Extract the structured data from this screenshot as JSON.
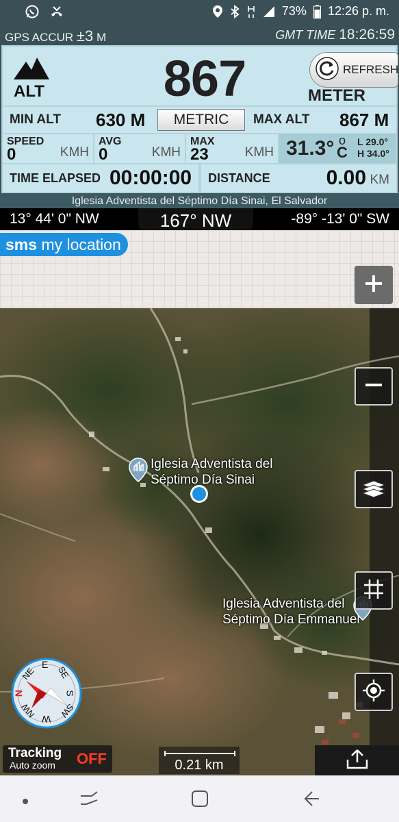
{
  "status_bar": {
    "battery": "73%",
    "time": "12:26 p. m."
  },
  "gps": {
    "accuracy_label": "GPS ACCUR",
    "accuracy_symbol": "±",
    "accuracy_value": "3",
    "accuracy_unit": "M",
    "gmt_label": "GMT TIME",
    "gmt_time": "18:26:59"
  },
  "altitude": {
    "label": "ALT",
    "value": "867",
    "unit": "METER",
    "refresh_label": "REFRESH"
  },
  "minmax": {
    "min_label": "MIN ALT",
    "min_value": "630 M",
    "metric_label": "METRIC",
    "max_label": "MAX ALT",
    "max_value": "867 M"
  },
  "speed": {
    "speed_label": "SPEED",
    "speed_value": "0",
    "speed_unit": "KMH",
    "avg_label": "AVG",
    "avg_value": "0",
    "avg_unit": "KMH",
    "max_label": "MAX",
    "max_value": "23",
    "max_unit": "KMH"
  },
  "temperature": {
    "value": "31.3°",
    "deg_sym": "o",
    "unit": "C",
    "low": "L 29.0°",
    "high": "H 34.0°"
  },
  "time_elapsed": {
    "label": "TIME ELAPSED",
    "value": "00:00:00"
  },
  "distance": {
    "label": "DISTANCE",
    "value": "0.00",
    "unit": "KM"
  },
  "location_name": "Iglesia Adventista del Séptimo Día Sinai, El Salvador",
  "compass": {
    "left": "13° 44' 0\" NW",
    "heading": "167° NW",
    "right": "-89° -13' 0\" SW"
  },
  "sms": {
    "bold": "sms",
    "rest": " my location"
  },
  "map": {
    "place1_line1": "Iglesia Adventista del",
    "place1_line2": "Séptimo Día Sinai",
    "place2_line1": "Iglesia Adventista del",
    "place2_line2": "Séptimo Día Emmanuel",
    "compass_letters": {
      "n": "N",
      "ne": "NE",
      "e": "E",
      "se": "SE",
      "s": "S",
      "sw": "SW",
      "w": "W",
      "nw": "NW"
    },
    "tracking_label": "Tracking",
    "autozoom_label": "Auto zoom",
    "tracking_state": "OFF",
    "scale": "0.21 km"
  },
  "colors": {
    "accent": "#1e90e0",
    "panel": "#c9e6ee",
    "off": "#ff3a2a"
  }
}
